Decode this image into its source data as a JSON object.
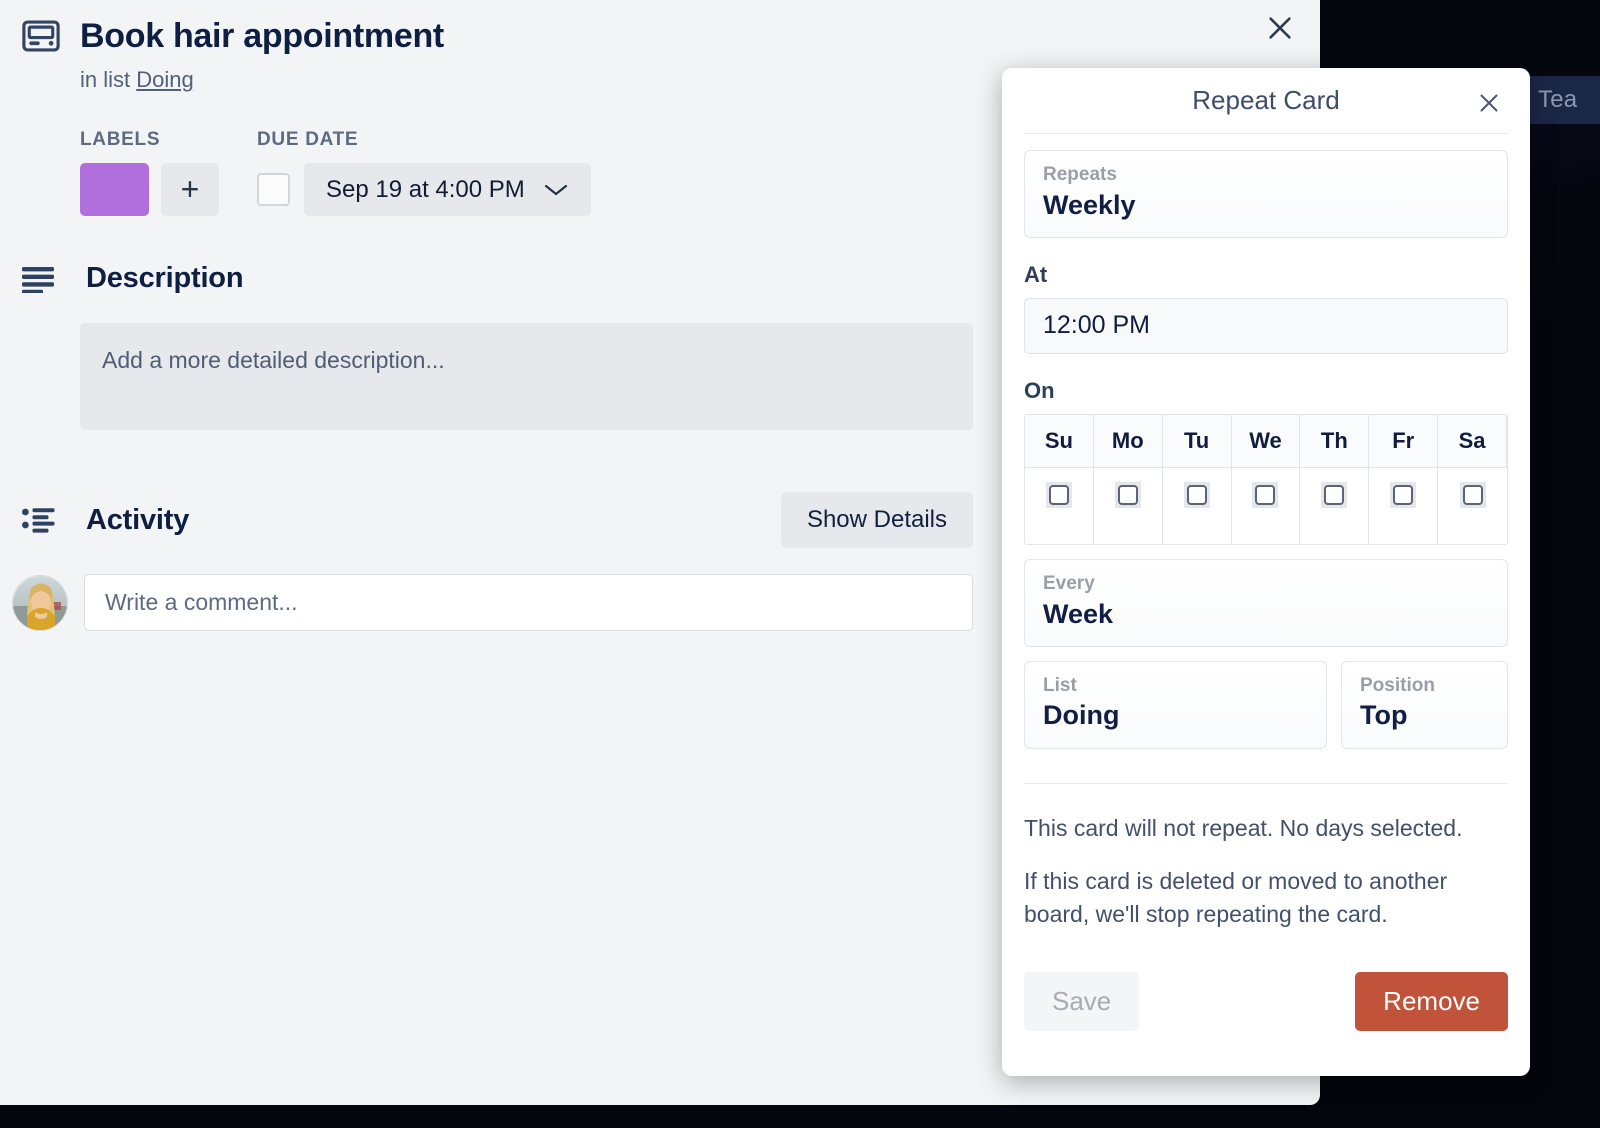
{
  "board": {
    "chip_label": "Tea",
    "background_color": "#0b1430"
  },
  "card": {
    "close_icon": "close-icon",
    "card_icon": "card-icon",
    "title": "Book hair appointment",
    "in_list_prefix": "in list",
    "list_name": "Doing",
    "labels": {
      "heading": "LABELS",
      "swatch_color": "#b06fdc",
      "add_label": "+"
    },
    "due_date": {
      "heading": "DUE DATE",
      "value": "Sep 19 at 4:00 PM",
      "checked": false
    },
    "description": {
      "icon": "description-lines-icon",
      "heading": "Description",
      "placeholder": "Add a more detailed description..."
    },
    "activity": {
      "icon": "activity-list-icon",
      "heading": "Activity",
      "show_details_label": "Show Details",
      "avatar": "user-avatar",
      "comment_placeholder": "Write a comment..."
    }
  },
  "repeat_modal": {
    "title": "Repeat Card",
    "close_icon": "close-icon",
    "repeats": {
      "label": "Repeats",
      "value": "Weekly"
    },
    "at": {
      "label": "At",
      "value": "12:00 PM"
    },
    "on": {
      "label": "On",
      "days": [
        {
          "abbr": "Su",
          "checked": false
        },
        {
          "abbr": "Mo",
          "checked": false
        },
        {
          "abbr": "Tu",
          "checked": false
        },
        {
          "abbr": "We",
          "checked": false
        },
        {
          "abbr": "Th",
          "checked": false
        },
        {
          "abbr": "Fr",
          "checked": false
        },
        {
          "abbr": "Sa",
          "checked": false
        }
      ]
    },
    "every": {
      "label": "Every",
      "value": "Week"
    },
    "list": {
      "label": "List",
      "value": "Doing"
    },
    "position": {
      "label": "Position",
      "value": "Top"
    },
    "note_1": "This card will not repeat. No days selected.",
    "note_2": "If this card is deleted or moved to another board, we'll stop repeating the card.",
    "save_label": "Save",
    "remove_label": "Remove",
    "remove_color": "#c0533a"
  }
}
